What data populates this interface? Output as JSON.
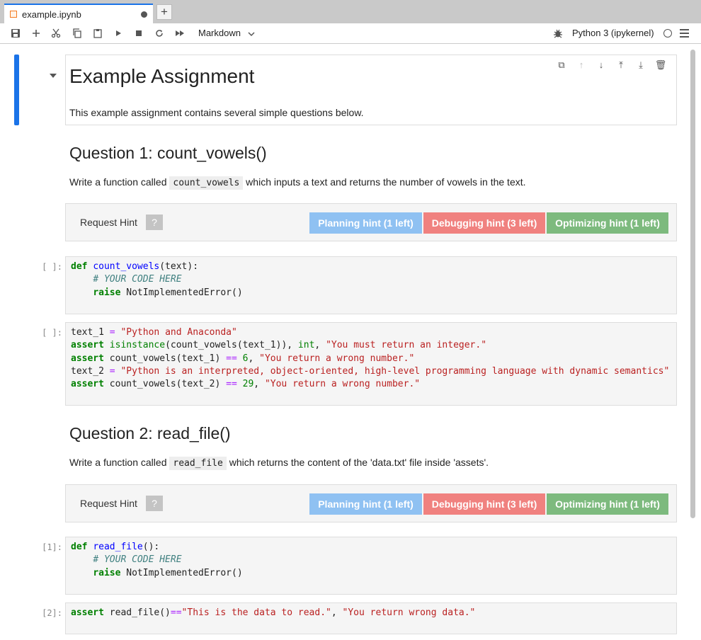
{
  "tab": {
    "title": "example.ipynb",
    "new_tab": "+"
  },
  "toolbar": {
    "cell_type": "Markdown",
    "kernel": "Python 3 (ipykernel)"
  },
  "md1": {
    "title": "Example Assignment",
    "text": "This example assignment contains several simple questions below."
  },
  "q1": {
    "title": "Question 1: count_vowels()",
    "text_before": "Write a function called ",
    "code": "count_vowels",
    "text_after": " which inputs a text and returns the number of vowels in the text."
  },
  "q2": {
    "title": "Question 2: read_file()",
    "text_before": "Write a function called ",
    "code": "read_file",
    "text_after": " which returns the content of the 'data.txt' file inside 'assets'."
  },
  "hint": {
    "request_label": "Request Hint",
    "help": "?",
    "planning": "Planning hint (1 left)",
    "debugging": "Debugging hint (3 left)",
    "optimizing": "Optimizing hint (1 left)"
  },
  "prompts": {
    "c1": "[ ]:",
    "c2": "[ ]:",
    "c3": "[1]:",
    "c4": "[2]:"
  },
  "code": {
    "def": "def",
    "raise": "raise",
    "assert": "assert",
    "comment": "# YOUR CODE HERE",
    "not_impl": " NotImplementedError()",
    "c1_fn": "count_vowels",
    "c1_args": "(text):",
    "c2_l1a": "text_1 ",
    "c2_l1s": "\"Python and Anaconda\"",
    "isinstance": "isinstance",
    "c2_l2b": "(count_vowels(text_1)), ",
    "int": "int",
    "c2_l2s": "\"You must return an integer.\"",
    "c2_l3a": " count_vowels(text_1) ",
    "six": "6",
    "c2_l3s": "\"You return a wrong number.\"",
    "c2_l4a": "text_2 ",
    "c2_l4s": "\"Python is an interpreted, object-oriented, high-level programming language with dynamic semantics\"",
    "c2_l5a": " count_vowels(text_2) ",
    "n29": "29",
    "c3_fn": "read_file",
    "c3_args": "():",
    "c4_a": " read_file()",
    "c4_s": "\"This is the data to read.\"",
    "c4_s2": "\"You return wrong data.\"",
    "eq": "=",
    "eqeq": "==",
    "comma": ", "
  }
}
